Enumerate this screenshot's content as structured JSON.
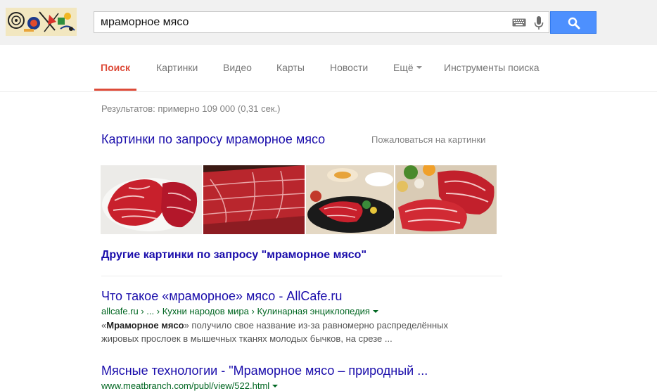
{
  "search": {
    "query": "мраморное мясо"
  },
  "colors": {
    "accent": "#dd4b39",
    "link": "#1a0dab",
    "url": "#006621",
    "button": "#4d90fe"
  },
  "nav": {
    "tabs": [
      {
        "label": "Поиск",
        "active": true
      },
      {
        "label": "Картинки"
      },
      {
        "label": "Видео"
      },
      {
        "label": "Карты"
      },
      {
        "label": "Новости"
      },
      {
        "label": "Ещё"
      },
      {
        "label": "Инструменты поиска"
      }
    ]
  },
  "stats": "Результатов: примерно 109 000 (0,31 сек.)",
  "images": {
    "heading": "Картинки по запросу мраморное мясо",
    "report": "Пожаловаться на картинки",
    "more": "Другие картинки по запросу \"мраморное мясо\""
  },
  "results": [
    {
      "title": "Что такое «мраморное» мясо - AllCafe.ru",
      "url": "allcafe.ru › ... › Кухни народов мира › Кулинарная энциклопедия",
      "snippet_open": "«",
      "snippet_bold": "Мраморное мясо",
      "snippet_line1": "» получило свое название из-за равномерно распределённых",
      "snippet_line2": "жировых прослоек в мышечных тканях молодых бычков, на срезе ..."
    },
    {
      "title": "Мясные технологии - \"Мраморное мясо – природный ...",
      "url": "www.meatbranch.com/publ/view/522.html"
    }
  ]
}
